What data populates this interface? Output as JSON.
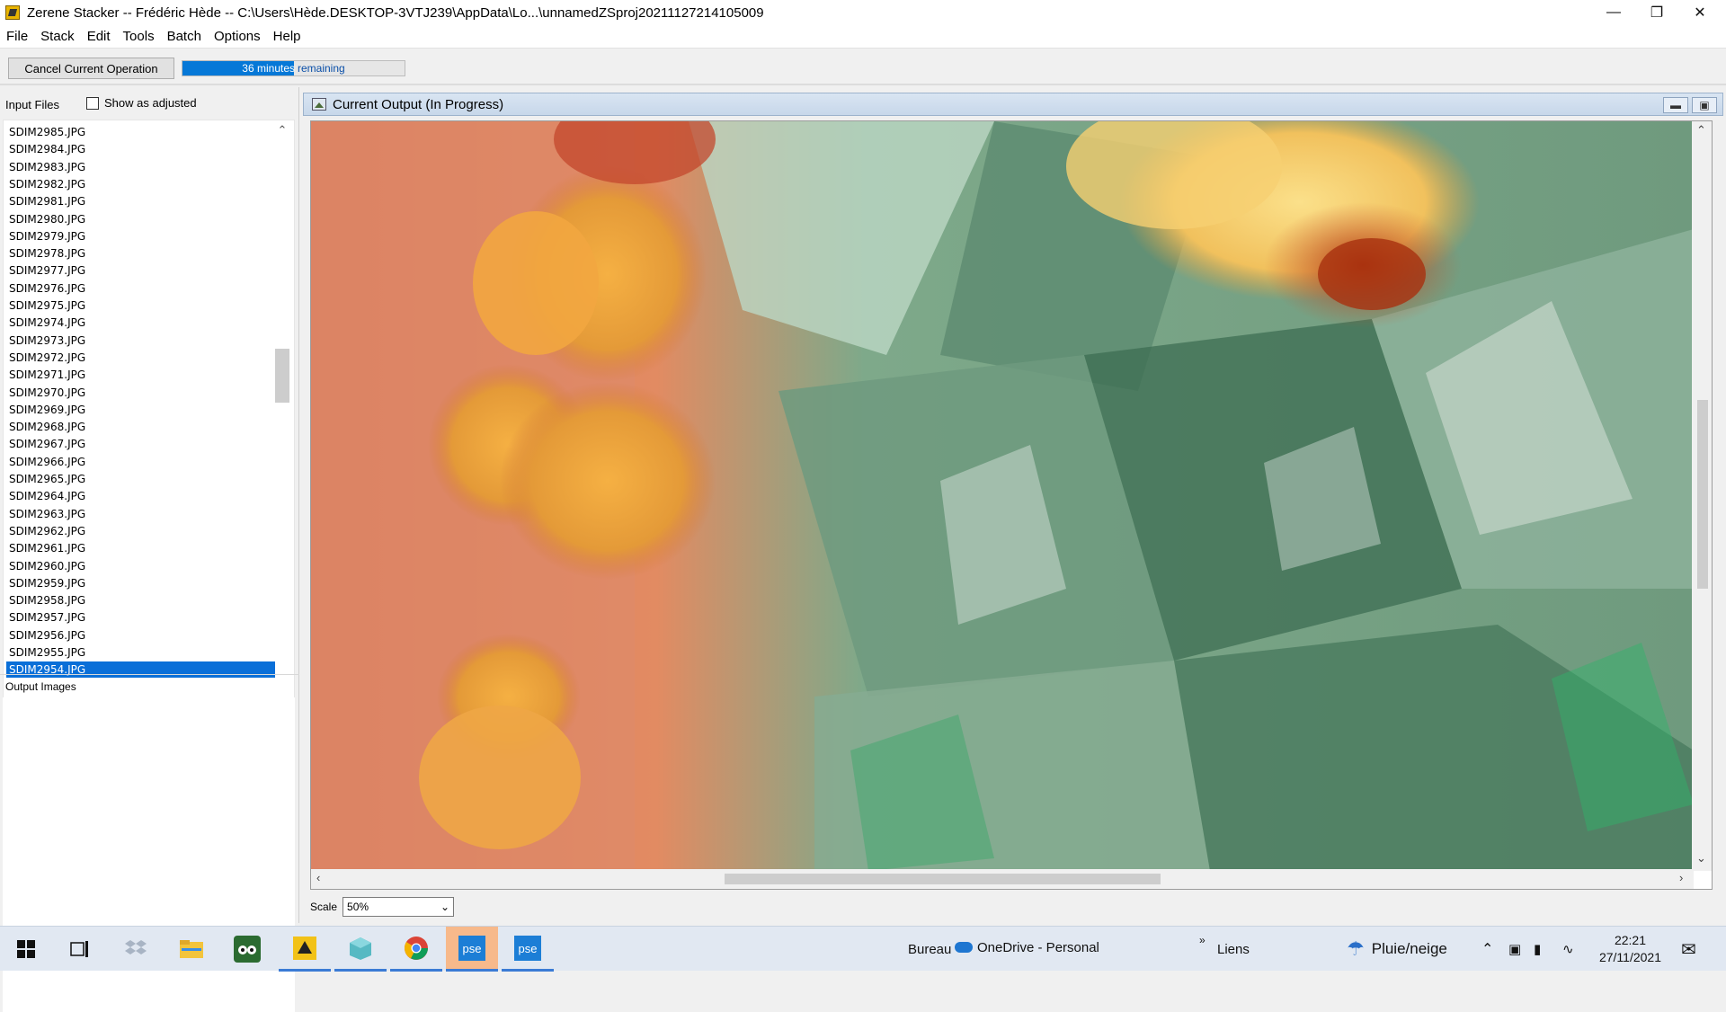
{
  "window": {
    "title": "Zerene Stacker -- Frédéric Hède -- C:\\Users\\Hède.DESKTOP-3VTJ239\\AppData\\Lo...\\unnamedZSproj20211127214105009",
    "controls": [
      "minimize",
      "maximize",
      "close"
    ]
  },
  "menu": [
    "File",
    "Stack",
    "Edit",
    "Tools",
    "Batch",
    "Options",
    "Help"
  ],
  "toolbar": {
    "cancel_label": "Cancel Current Operation",
    "progress_value": "36 minutes",
    "progress_suffix": "remaining",
    "progress_fraction": 0.5
  },
  "input_panel": {
    "header": "Input Files",
    "show_adjusted_label": "Show as adjusted",
    "show_adjusted_checked": false,
    "files": [
      "SDIM2985.JPG",
      "SDIM2984.JPG",
      "SDIM2983.JPG",
      "SDIM2982.JPG",
      "SDIM2981.JPG",
      "SDIM2980.JPG",
      "SDIM2979.JPG",
      "SDIM2978.JPG",
      "SDIM2977.JPG",
      "SDIM2976.JPG",
      "SDIM2975.JPG",
      "SDIM2974.JPG",
      "SDIM2973.JPG",
      "SDIM2972.JPG",
      "SDIM2971.JPG",
      "SDIM2970.JPG",
      "SDIM2969.JPG",
      "SDIM2968.JPG",
      "SDIM2967.JPG",
      "SDIM2966.JPG",
      "SDIM2965.JPG",
      "SDIM2964.JPG",
      "SDIM2963.JPG",
      "SDIM2962.JPG",
      "SDIM2961.JPG",
      "SDIM2960.JPG",
      "SDIM2959.JPG",
      "SDIM2958.JPG",
      "SDIM2957.JPG",
      "SDIM2956.JPG",
      "SDIM2955.JPG",
      "SDIM2954.JPG"
    ],
    "selected_file": "SDIM2954.JPG"
  },
  "output_panel": {
    "header": "Output Images"
  },
  "output_window": {
    "title": "Current Output (In Progress)",
    "scale_label": "Scale",
    "scale_value": "50%"
  },
  "taskbar": {
    "apps": [
      "start-icon",
      "task-view-icon",
      "dropbox-icon",
      "file-explorer-icon",
      "tripadvisor-icon",
      "zerene-stacker-icon",
      "cube-app-icon",
      "chrome-icon",
      "pse-icon",
      "pse-icon-2"
    ],
    "bureau": "Bureau",
    "onedrive": "OneDrive - Personal",
    "links": "Liens",
    "weather": "Pluie/neige",
    "time": "22:21",
    "date": "27/11/2021"
  },
  "colors": {
    "accent": "#0678d7",
    "selection": "#0a6fd8",
    "inner_title": "#c7d7ea",
    "pse_highlight": "#f7b98b"
  }
}
